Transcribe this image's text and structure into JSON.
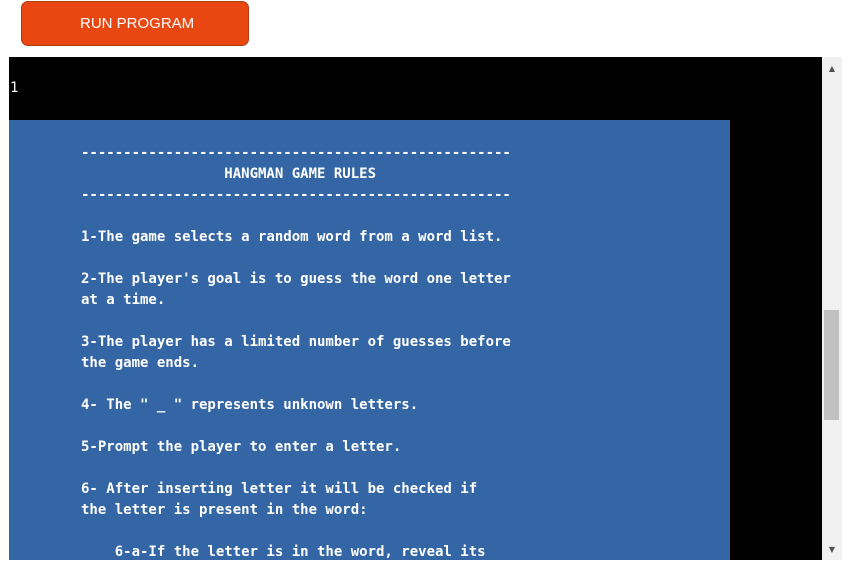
{
  "toolbar": {
    "run_label": "RUN PROGRAM"
  },
  "terminal": {
    "output_line": "1",
    "rules_lines": [
      "---------------------------------------------------",
      "                 HANGMAN GAME RULES",
      "---------------------------------------------------",
      "",
      "1-The game selects a random word from a word list.",
      "",
      "2-The player's goal is to guess the word one letter",
      "at a time.",
      "",
      "3-The player has a limited number of guesses before",
      "the game ends.",
      "",
      "4- The \" _ \" represents unknown letters.",
      "",
      "5-Prompt the player to enter a letter.",
      "",
      "6- After inserting letter it will be checked if",
      "the letter is present in the word:",
      "",
      "    6-a-If the letter is in the word, reveal its"
    ]
  },
  "scrollbar": {
    "up_icon": "▲",
    "down_icon": "▼"
  },
  "colors": {
    "run_button": "#e84711",
    "terminal_bg": "#000000",
    "panel_bg": "#3465a4",
    "text": "#ffffff"
  }
}
